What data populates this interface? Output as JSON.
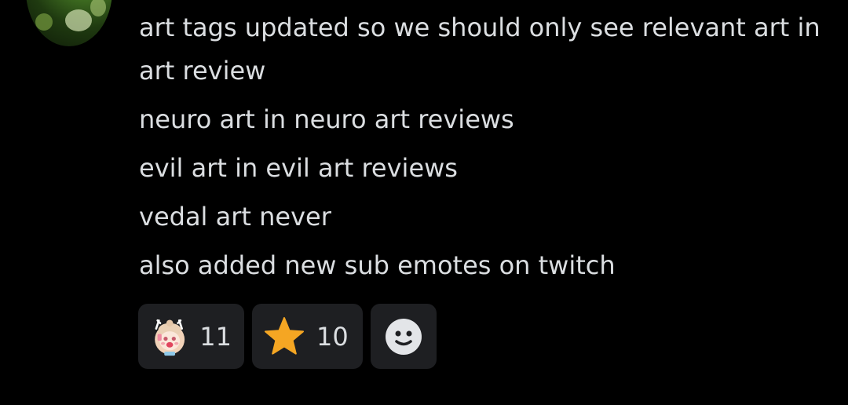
{
  "messages": [
    "art tags updated so we should only see relevant art in art review",
    "neuro art in neuro art reviews",
    "evil art in evil art reviews",
    "vedal art never",
    "also added new sub emotes on twitch"
  ],
  "reactions": [
    {
      "icon": "anime-girl-emote-icon",
      "count": "11"
    },
    {
      "icon": "star-icon",
      "count": "10",
      "color": "#f5a623"
    },
    {
      "icon": "add-reaction-icon"
    }
  ]
}
